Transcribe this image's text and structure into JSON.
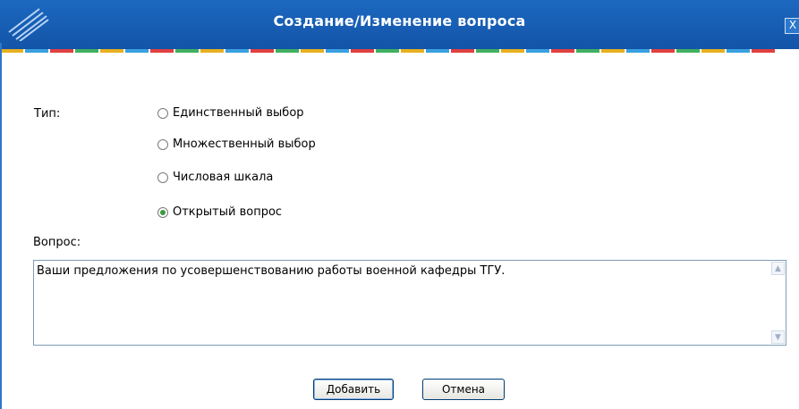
{
  "dialog": {
    "title": "Создание/Изменение вопроса",
    "close_glyph": "X"
  },
  "form": {
    "type_label": "Тип:",
    "options": [
      {
        "label": "Единственный выбор",
        "checked": false
      },
      {
        "label": "Множественный выбор",
        "checked": false
      },
      {
        "label": "Числовая шкала",
        "checked": false
      },
      {
        "label": "Открытый вопрос",
        "checked": true
      }
    ],
    "question_label": "Вопрос:",
    "question_value": "Ваши предложения по усовершенствованию работы военной кафедры ТГУ."
  },
  "buttons": {
    "add_label": "Добавить",
    "cancel_label": "Отмена"
  },
  "colors": {
    "titlebar": "#1d68c0",
    "radio_checked": "#3c9a3c"
  }
}
